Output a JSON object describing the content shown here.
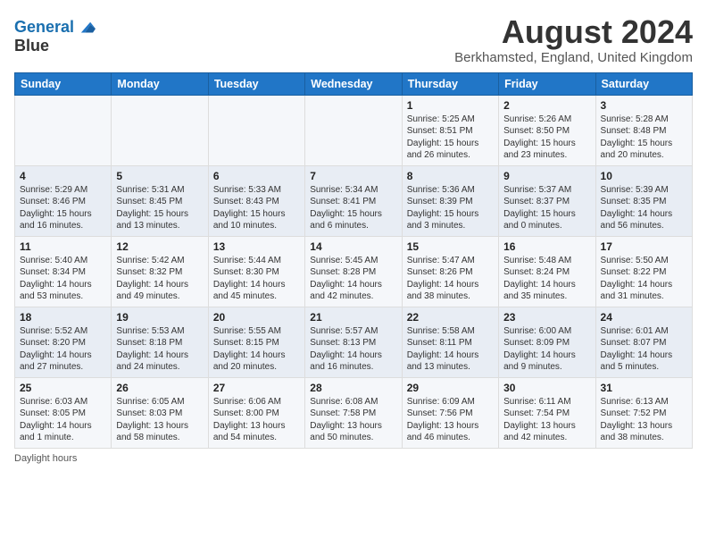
{
  "header": {
    "logo_line1": "General",
    "logo_line2": "Blue",
    "month_title": "August 2024",
    "location": "Berkhamsted, England, United Kingdom"
  },
  "days_of_week": [
    "Sunday",
    "Monday",
    "Tuesday",
    "Wednesday",
    "Thursday",
    "Friday",
    "Saturday"
  ],
  "weeks": [
    [
      {
        "day": "",
        "data": ""
      },
      {
        "day": "",
        "data": ""
      },
      {
        "day": "",
        "data": ""
      },
      {
        "day": "",
        "data": ""
      },
      {
        "day": "1",
        "data": "Sunrise: 5:25 AM\nSunset: 8:51 PM\nDaylight: 15 hours and 26 minutes."
      },
      {
        "day": "2",
        "data": "Sunrise: 5:26 AM\nSunset: 8:50 PM\nDaylight: 15 hours and 23 minutes."
      },
      {
        "day": "3",
        "data": "Sunrise: 5:28 AM\nSunset: 8:48 PM\nDaylight: 15 hours and 20 minutes."
      }
    ],
    [
      {
        "day": "4",
        "data": "Sunrise: 5:29 AM\nSunset: 8:46 PM\nDaylight: 15 hours and 16 minutes."
      },
      {
        "day": "5",
        "data": "Sunrise: 5:31 AM\nSunset: 8:45 PM\nDaylight: 15 hours and 13 minutes."
      },
      {
        "day": "6",
        "data": "Sunrise: 5:33 AM\nSunset: 8:43 PM\nDaylight: 15 hours and 10 minutes."
      },
      {
        "day": "7",
        "data": "Sunrise: 5:34 AM\nSunset: 8:41 PM\nDaylight: 15 hours and 6 minutes."
      },
      {
        "day": "8",
        "data": "Sunrise: 5:36 AM\nSunset: 8:39 PM\nDaylight: 15 hours and 3 minutes."
      },
      {
        "day": "9",
        "data": "Sunrise: 5:37 AM\nSunset: 8:37 PM\nDaylight: 15 hours and 0 minutes."
      },
      {
        "day": "10",
        "data": "Sunrise: 5:39 AM\nSunset: 8:35 PM\nDaylight: 14 hours and 56 minutes."
      }
    ],
    [
      {
        "day": "11",
        "data": "Sunrise: 5:40 AM\nSunset: 8:34 PM\nDaylight: 14 hours and 53 minutes."
      },
      {
        "day": "12",
        "data": "Sunrise: 5:42 AM\nSunset: 8:32 PM\nDaylight: 14 hours and 49 minutes."
      },
      {
        "day": "13",
        "data": "Sunrise: 5:44 AM\nSunset: 8:30 PM\nDaylight: 14 hours and 45 minutes."
      },
      {
        "day": "14",
        "data": "Sunrise: 5:45 AM\nSunset: 8:28 PM\nDaylight: 14 hours and 42 minutes."
      },
      {
        "day": "15",
        "data": "Sunrise: 5:47 AM\nSunset: 8:26 PM\nDaylight: 14 hours and 38 minutes."
      },
      {
        "day": "16",
        "data": "Sunrise: 5:48 AM\nSunset: 8:24 PM\nDaylight: 14 hours and 35 minutes."
      },
      {
        "day": "17",
        "data": "Sunrise: 5:50 AM\nSunset: 8:22 PM\nDaylight: 14 hours and 31 minutes."
      }
    ],
    [
      {
        "day": "18",
        "data": "Sunrise: 5:52 AM\nSunset: 8:20 PM\nDaylight: 14 hours and 27 minutes."
      },
      {
        "day": "19",
        "data": "Sunrise: 5:53 AM\nSunset: 8:18 PM\nDaylight: 14 hours and 24 minutes."
      },
      {
        "day": "20",
        "data": "Sunrise: 5:55 AM\nSunset: 8:15 PM\nDaylight: 14 hours and 20 minutes."
      },
      {
        "day": "21",
        "data": "Sunrise: 5:57 AM\nSunset: 8:13 PM\nDaylight: 14 hours and 16 minutes."
      },
      {
        "day": "22",
        "data": "Sunrise: 5:58 AM\nSunset: 8:11 PM\nDaylight: 14 hours and 13 minutes."
      },
      {
        "day": "23",
        "data": "Sunrise: 6:00 AM\nSunset: 8:09 PM\nDaylight: 14 hours and 9 minutes."
      },
      {
        "day": "24",
        "data": "Sunrise: 6:01 AM\nSunset: 8:07 PM\nDaylight: 14 hours and 5 minutes."
      }
    ],
    [
      {
        "day": "25",
        "data": "Sunrise: 6:03 AM\nSunset: 8:05 PM\nDaylight: 14 hours and 1 minute."
      },
      {
        "day": "26",
        "data": "Sunrise: 6:05 AM\nSunset: 8:03 PM\nDaylight: 13 hours and 58 minutes."
      },
      {
        "day": "27",
        "data": "Sunrise: 6:06 AM\nSunset: 8:00 PM\nDaylight: 13 hours and 54 minutes."
      },
      {
        "day": "28",
        "data": "Sunrise: 6:08 AM\nSunset: 7:58 PM\nDaylight: 13 hours and 50 minutes."
      },
      {
        "day": "29",
        "data": "Sunrise: 6:09 AM\nSunset: 7:56 PM\nDaylight: 13 hours and 46 minutes."
      },
      {
        "day": "30",
        "data": "Sunrise: 6:11 AM\nSunset: 7:54 PM\nDaylight: 13 hours and 42 minutes."
      },
      {
        "day": "31",
        "data": "Sunrise: 6:13 AM\nSunset: 7:52 PM\nDaylight: 13 hours and 38 minutes."
      }
    ]
  ],
  "footer": {
    "note": "Daylight hours"
  }
}
